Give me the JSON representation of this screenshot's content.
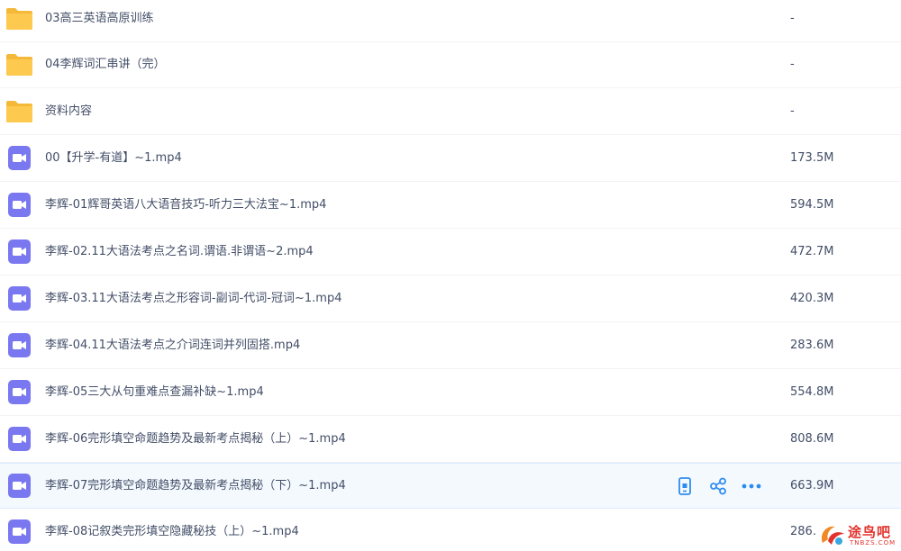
{
  "file_list": {
    "rows": [
      {
        "type": "folder",
        "name": "03高三英语高原训练",
        "size": "-"
      },
      {
        "type": "folder",
        "name": "04李辉词汇串讲（完）",
        "size": "-"
      },
      {
        "type": "folder",
        "name": "资料内容",
        "size": "-"
      },
      {
        "type": "video",
        "name": "00【升学-有道】~1.mp4",
        "size": "173.5M"
      },
      {
        "type": "video",
        "name": "李辉-01辉哥英语八大语音技巧-听力三大法宝~1.mp4",
        "size": "594.5M"
      },
      {
        "type": "video",
        "name": "李辉-02.11大语法考点之名词.谓语.非谓语~2.mp4",
        "size": "472.7M"
      },
      {
        "type": "video",
        "name": "李辉-03.11大语法考点之形容词-副词-代词-冠词~1.mp4",
        "size": "420.3M"
      },
      {
        "type": "video",
        "name": "李辉-04.11大语法考点之介词连词并列固搭.mp4",
        "size": "283.6M"
      },
      {
        "type": "video",
        "name": "李辉-05三大从句重难点查漏补缺~1.mp4",
        "size": "554.8M"
      },
      {
        "type": "video",
        "name": "李辉-06完形填空命题趋势及最新考点揭秘（上）~1.mp4",
        "size": "808.6M"
      },
      {
        "type": "video",
        "name": "李辉-07完形填空命题趋势及最新考点揭秘（下）~1.mp4",
        "size": "663.9M"
      },
      {
        "type": "video",
        "name": "李辉-08记叙类完形填空隐藏秘技（上）~1.mp4",
        "size": "286."
      }
    ],
    "hovered_row_index": 10,
    "row_actions": [
      {
        "name": "phone-icon",
        "label": "send-to-phone"
      },
      {
        "name": "share-icon",
        "label": "share"
      },
      {
        "name": "more-icon",
        "label": "more"
      }
    ]
  },
  "watermark": {
    "text": "途鸟吧",
    "sub": "TNBZS.COM"
  },
  "colors": {
    "folder": "#fdc94e",
    "video": "#7a78f0",
    "action_icon": "#2e8cf0",
    "text": "#424e67",
    "hover_bg": "#f4f9fe",
    "watermark": "#e3332d"
  }
}
